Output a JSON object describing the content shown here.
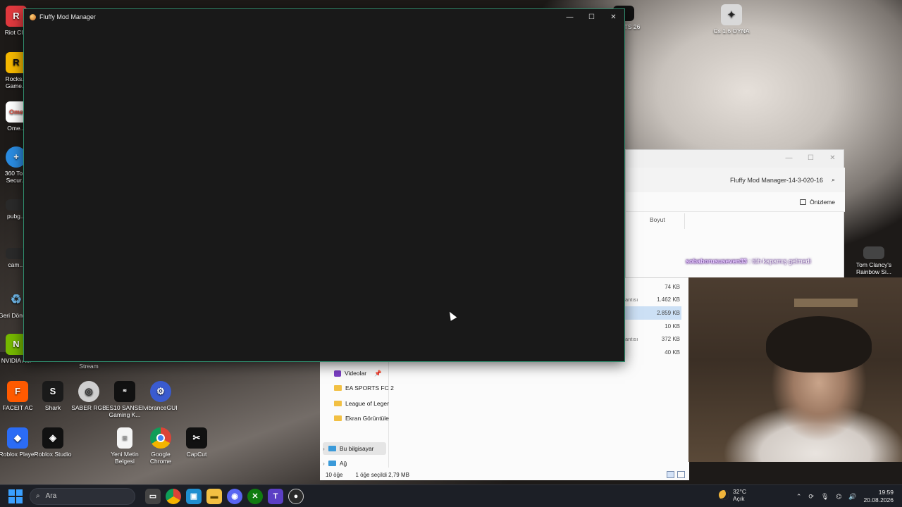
{
  "fluffy_window": {
    "title": "Fluffy Mod Manager",
    "minimize": "—",
    "maximize": "☐",
    "close": "✕"
  },
  "explorer": {
    "path_text": "Fluffy Mod Manager-14-3-020-16",
    "preview_label": "Önizleme",
    "size_column": "Boyut",
    "type_hint_1": "antısı",
    "type_hint_2": "antısı",
    "file_sizes": [
      "74 KB",
      "1.462 KB",
      "2.859 KB",
      "10 KB",
      "372 KB",
      "40 KB"
    ],
    "nav": {
      "videolar": "Videolar",
      "ea": "EA SPORTS FC 2",
      "lol": "League of Leger",
      "ekran": "Ekran Görüntüle",
      "pc": "Bu bilgisayar",
      "ag": "Ağ"
    },
    "status": {
      "count": "10 öğe",
      "selected": "1 öğe seçildi  2,79 MB"
    }
  },
  "desktop_icons": {
    "riot": "Riot Cl...",
    "rockstar": "Rocks... Game...",
    "ome": "Ome...",
    "secure": "360 To... Secur...",
    "pubg": "pubg...",
    "cam": "cam...",
    "geri": "Geri Dönüş...",
    "nvidia": "NVIDIA A...",
    "faceit": "FACEIT AC",
    "shark": "Shark",
    "saber": "SABER RGB",
    "es10": "ES10 SANSEI Gaming K...",
    "vibrance": "vibranceGUI",
    "roblox_player": "Roblox Player",
    "roblox_studio": "Roblox Studio",
    "yeni_metin": "Yeni Metin Belgesi",
    "chrome": "Google Chrome",
    "capcut": "CapCut",
    "stream": "Stream",
    "cs": "Cs 1.6 OYNA",
    "fc_sports": "SPORTS 26",
    "rainbow": "Tom Clancy's Rainbow Si..."
  },
  "chat": {
    "user": "sobaborususeven33",
    "message": ": tüh kapamış gelmedi"
  },
  "taskbar": {
    "search_placeholder": "Ara",
    "weather_temp": "32°C",
    "weather_desc": "Açık",
    "time": "19:59",
    "date": "20.08.2026"
  },
  "colors": {
    "fluffy_border": "#2f8a6b",
    "taskbar": "#1c1f26",
    "folder": "#f2c043"
  }
}
